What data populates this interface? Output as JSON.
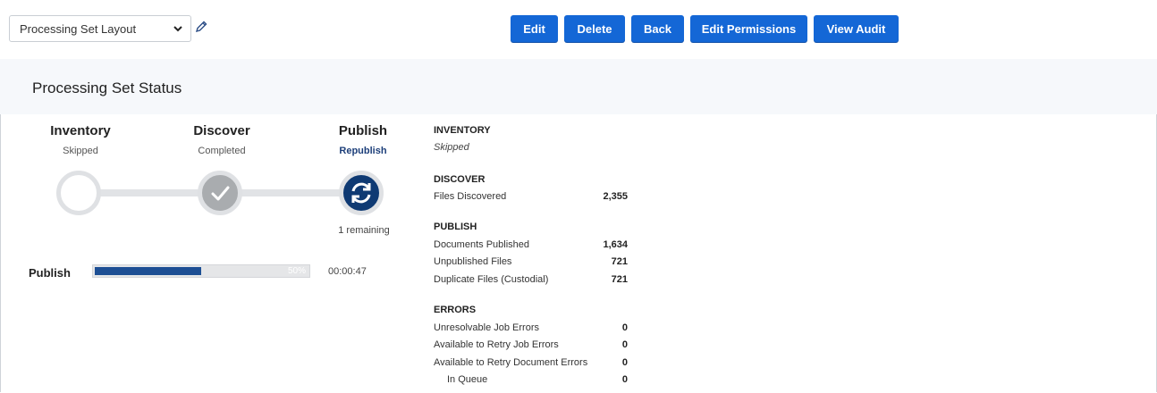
{
  "toolbar": {
    "layout_value": "Processing Set Layout",
    "edit_label": "Edit",
    "delete_label": "Delete",
    "back_label": "Back",
    "edit_permissions_label": "Edit Permissions",
    "view_audit_label": "View Audit",
    "accent_color": "#1467d6"
  },
  "page": {
    "title": "Processing Set Status"
  },
  "steps": [
    {
      "title": "Inventory",
      "status": "Skipped",
      "icon": "empty-circle-icon"
    },
    {
      "title": "Discover",
      "status": "Completed",
      "icon": "checkmark-icon"
    },
    {
      "title": "Publish",
      "status": "Republish",
      "icon": "refresh-icon",
      "remaining": "1 remaining"
    }
  ],
  "progress": {
    "label": "Publish",
    "percent": 50,
    "percent_label": "50%",
    "elapsed": "00:00:47",
    "fill_color": "#1d4f94"
  },
  "summary": {
    "inventory": {
      "heading": "INVENTORY",
      "status": "Skipped"
    },
    "discover": {
      "heading": "DISCOVER",
      "rows": [
        {
          "label": "Files Discovered",
          "value": "2,355"
        }
      ]
    },
    "publish": {
      "heading": "PUBLISH",
      "rows": [
        {
          "label": "Documents Published",
          "value": "1,634"
        },
        {
          "label": "Unpublished Files",
          "value": "721"
        },
        {
          "label": "Duplicate Files (Custodial)",
          "value": "721"
        }
      ]
    },
    "errors": {
      "heading": "ERRORS",
      "rows": [
        {
          "label": "Unresolvable Job Errors",
          "value": "0"
        },
        {
          "label": "Available to Retry Job Errors",
          "value": "0"
        },
        {
          "label": "Available to Retry Document Errors",
          "value": "0"
        },
        {
          "label": "In Queue",
          "value": "0"
        }
      ]
    }
  }
}
